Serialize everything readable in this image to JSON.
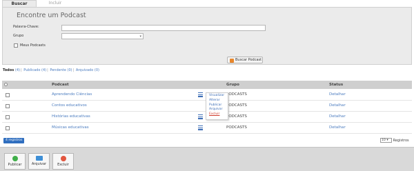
{
  "tabs": [
    {
      "label": "Buscar"
    },
    {
      "label": "Incluir"
    }
  ],
  "search": {
    "title": "Encontre um Podcast",
    "keyword_label": "Palavra-Chave:",
    "keyword_value": "",
    "group_label": "Grupo",
    "group_value": "",
    "my_podcasts_label": "Meus Podcasts",
    "button_label": "Buscar Podcast"
  },
  "filters": [
    {
      "label": "Todos",
      "count": "(4)"
    },
    {
      "label": "Publicado",
      "count": "(4)"
    },
    {
      "label": "Pendente",
      "count": "(0)"
    },
    {
      "label": "Arquivado",
      "count": "(0)"
    }
  ],
  "table": {
    "headers": {
      "podcast": "Podcast",
      "grupo": "Grupo",
      "status": "Status"
    },
    "rows": [
      {
        "name": "Aprendendo Ciências",
        "group": "PODCASTS",
        "status": "Detalhar"
      },
      {
        "name": "Contos educativos",
        "group": "PODCASTS",
        "status": "Detalhar"
      },
      {
        "name": "Histórias educativas",
        "group": "PODCASTS",
        "status": "Detalhar"
      },
      {
        "name": "Músicas educativas",
        "group": "PODCASTS",
        "status": "Detalhar"
      }
    ]
  },
  "context_menu": {
    "items": [
      "Visualizar",
      "Alterar",
      "Publicar",
      "Arquivar",
      "Excluir"
    ]
  },
  "records": {
    "badge": "4 registros",
    "per_page": "10",
    "per_page_label": "Registros"
  },
  "footer": {
    "buttons": [
      {
        "label": "Publicar",
        "color": "#3fae49"
      },
      {
        "label": "Arquivar",
        "color": "#3e8fd6"
      },
      {
        "label": "Excluir",
        "color": "#e2563f"
      }
    ]
  }
}
